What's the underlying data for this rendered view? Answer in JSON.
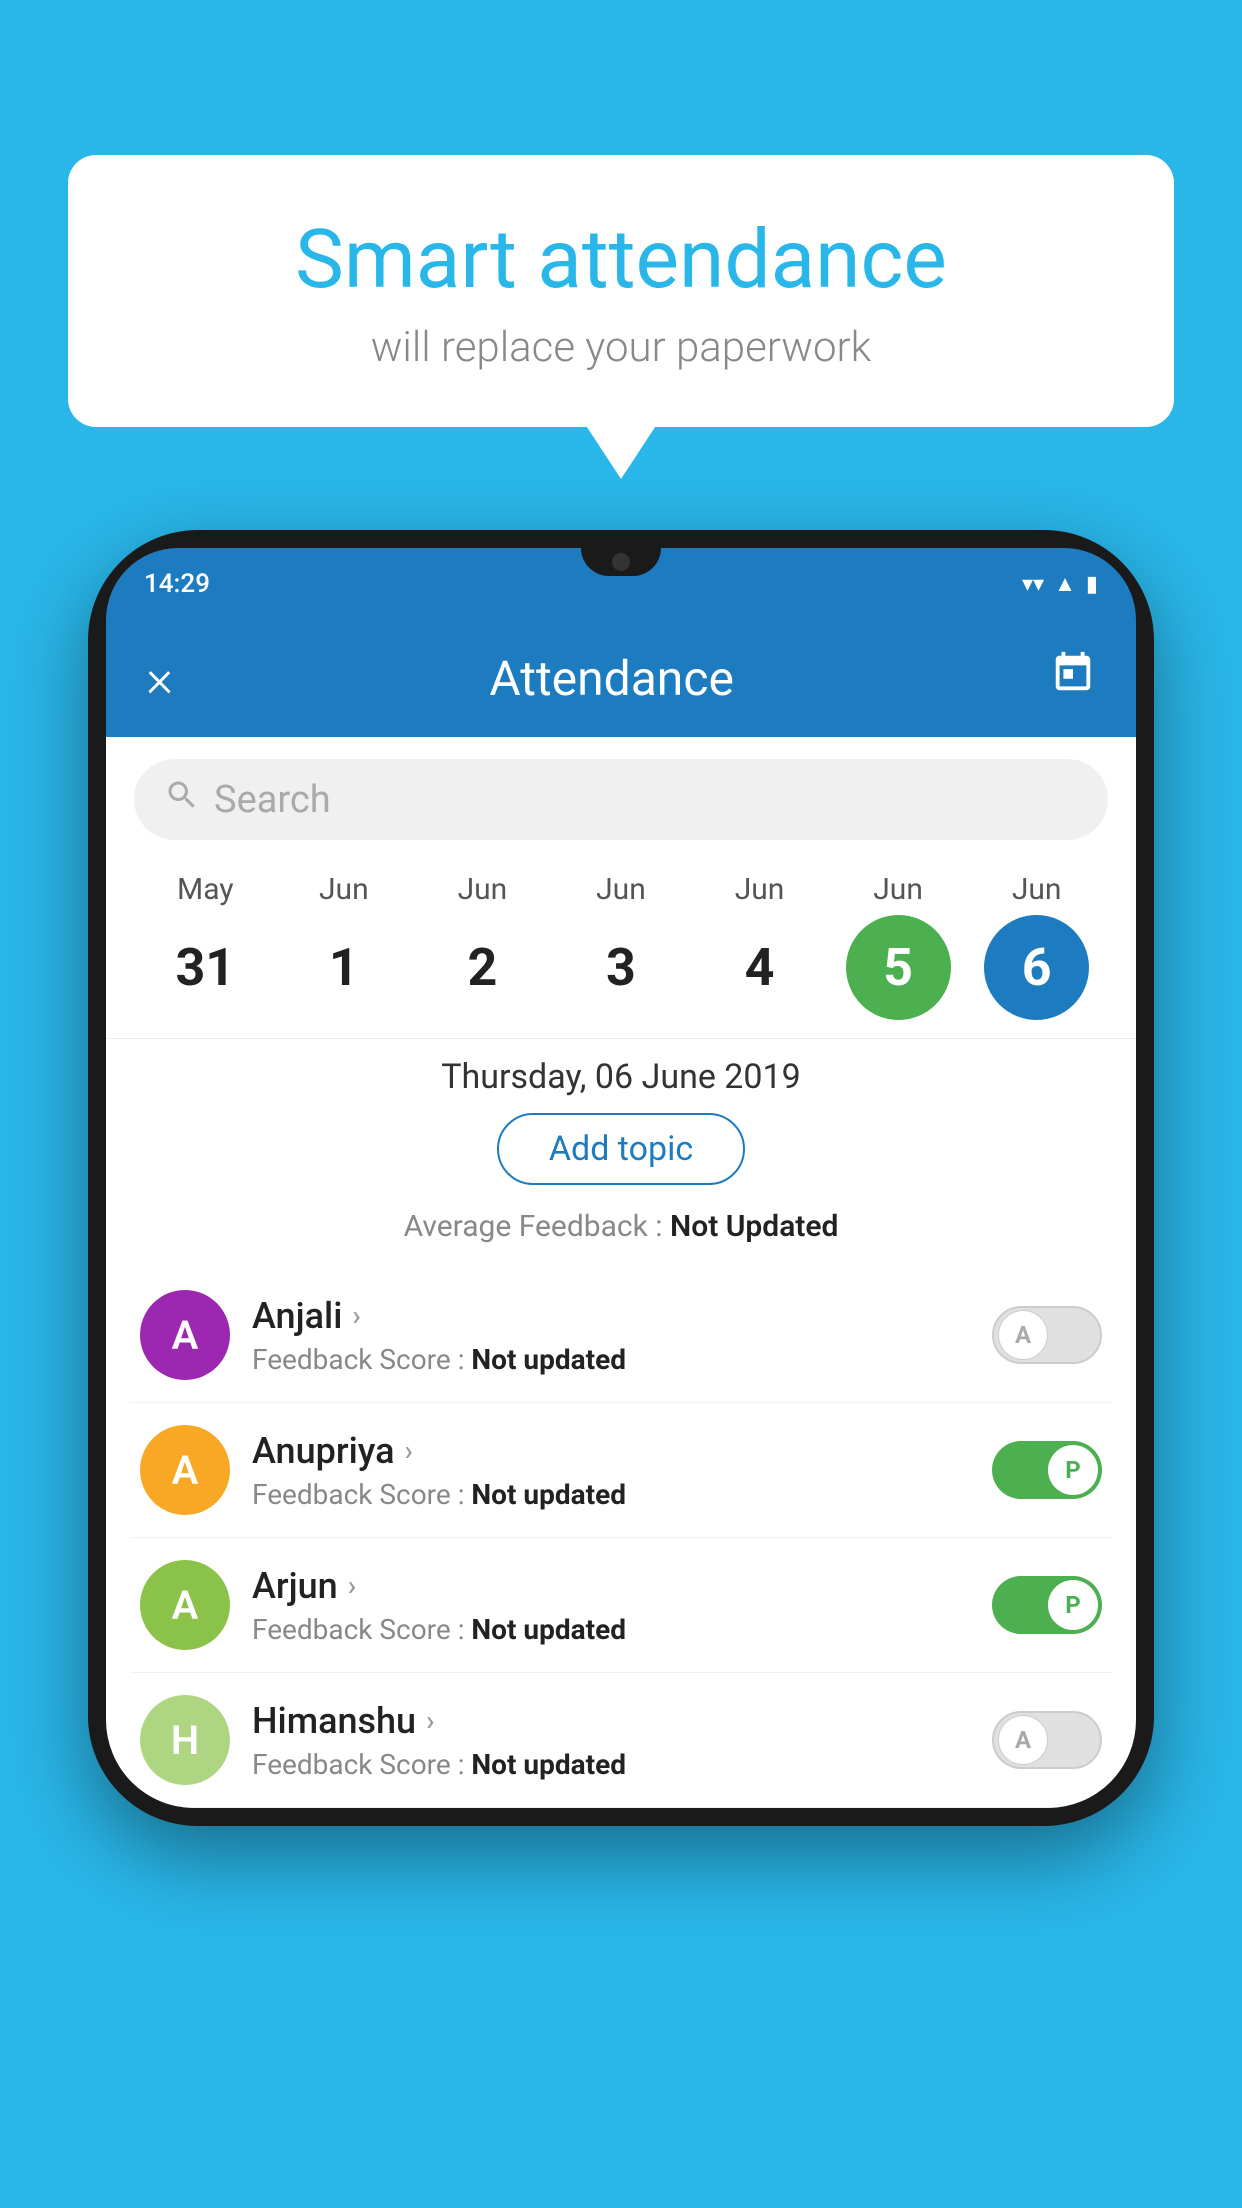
{
  "background_color": "#29b6e8",
  "bubble": {
    "title": "Smart attendance",
    "subtitle": "will replace your paperwork"
  },
  "status_bar": {
    "time": "14:29",
    "icons": [
      "wifi",
      "signal",
      "battery"
    ]
  },
  "app_bar": {
    "title": "Attendance",
    "close_label": "×",
    "calendar_label": "📅"
  },
  "search": {
    "placeholder": "Search"
  },
  "calendar": {
    "months": [
      "May",
      "Jun",
      "Jun",
      "Jun",
      "Jun",
      "Jun",
      "Jun"
    ],
    "dates": [
      "31",
      "1",
      "2",
      "3",
      "4",
      "5",
      "6"
    ],
    "selected_index": 6,
    "today_index": 5
  },
  "selected_date_label": "Thursday, 06 June 2019",
  "add_topic_label": "Add topic",
  "avg_feedback_label": "Average Feedback : ",
  "avg_feedback_value": "Not Updated",
  "students": [
    {
      "name": "Anjali",
      "avatar_letter": "A",
      "avatar_color": "#9c27b0",
      "feedback_label": "Feedback Score : ",
      "feedback_value": "Not updated",
      "status": "absent",
      "toggle_letter": "A"
    },
    {
      "name": "Anupriya",
      "avatar_letter": "A",
      "avatar_color": "#f9a825",
      "feedback_label": "Feedback Score : ",
      "feedback_value": "Not updated",
      "status": "present",
      "toggle_letter": "P"
    },
    {
      "name": "Arjun",
      "avatar_letter": "A",
      "avatar_color": "#8bc34a",
      "feedback_label": "Feedback Score : ",
      "feedback_value": "Not updated",
      "status": "present",
      "toggle_letter": "P"
    },
    {
      "name": "Himanshu",
      "avatar_letter": "H",
      "avatar_color": "#aed581",
      "feedback_label": "Feedback Score : ",
      "feedback_value": "Not updated",
      "status": "absent",
      "toggle_letter": "A"
    }
  ]
}
